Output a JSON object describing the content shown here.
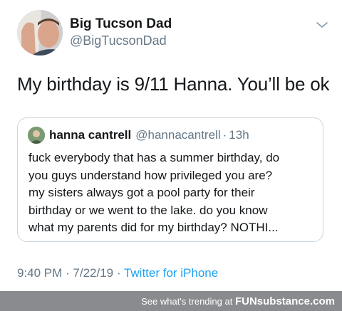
{
  "tweet": {
    "author_name": "Big Tucson Dad",
    "author_handle": "@BigTucsonDad",
    "text": "My birthday is 9/11 Hanna. You’ll be ok",
    "timestamp": "9:40 PM · 7/22/19 · ",
    "source": "Twitter for iPhone"
  },
  "quoted_tweet": {
    "author_name": "hanna cantrell",
    "author_handle": "@hannacantrell",
    "separator": "·",
    "age": "13h",
    "lines": [
      "fuck everybody that has a summer birthday, do",
      "you guys understand how privileged you are?",
      "my sisters always got a pool party for their",
      "birthday or we went to the lake. do you know",
      "what my parents did for my birthday? NOTHI..."
    ]
  },
  "watermark": {
    "prefix": "See what's trending at ",
    "brand": "FUNsubstance.com"
  },
  "icons": {
    "menu": "chevron-down-icon"
  },
  "colors": {
    "secondary_text": "#657786",
    "link": "#1da1f2",
    "banner": "#8a8b8e"
  }
}
